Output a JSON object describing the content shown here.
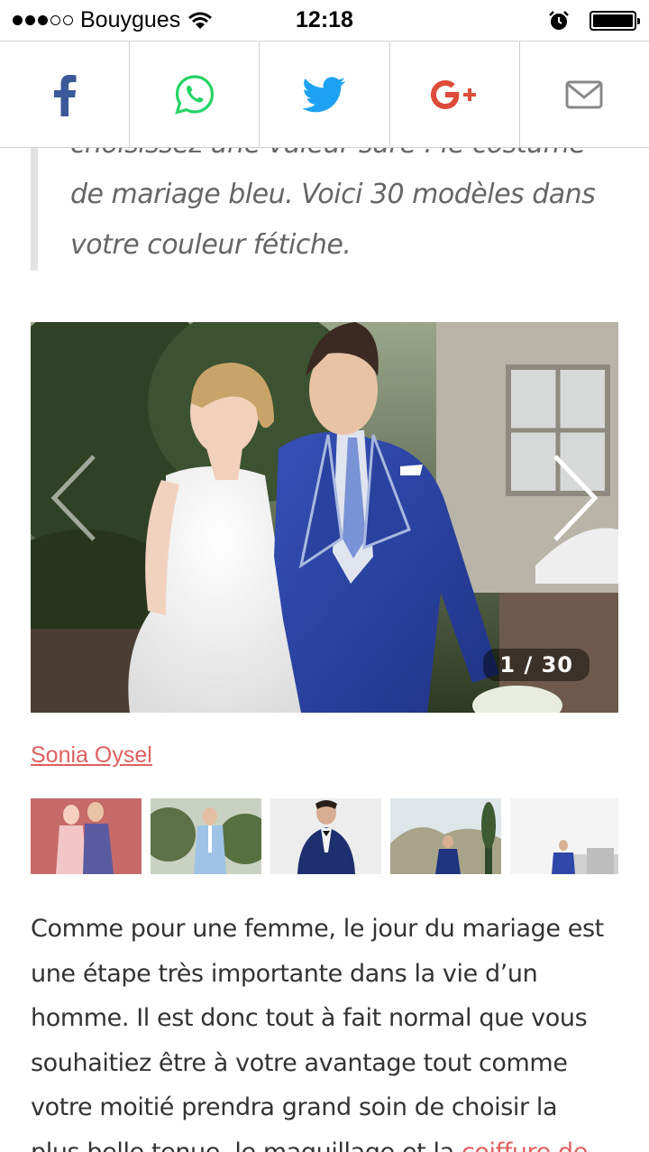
{
  "status_bar": {
    "carrier": "Bouygues",
    "time": "12:18",
    "signal_bars": 3,
    "signal_total": 5,
    "battery_level": 1.0
  },
  "share_bar": {
    "buttons": [
      {
        "network": "facebook",
        "icon": "facebook-icon",
        "color": "#3b5998"
      },
      {
        "network": "whatsapp",
        "icon": "whatsapp-icon",
        "color": "#25d366"
      },
      {
        "network": "twitter",
        "icon": "twitter-icon",
        "color": "#1da1f2"
      },
      {
        "network": "google-plus",
        "icon": "google-plus-icon",
        "color": "#dd4b39",
        "label": "G+"
      },
      {
        "network": "email",
        "icon": "envelope-icon",
        "color": "#888888"
      }
    ]
  },
  "article": {
    "quote_partial_line": "choisissez une valeur sûre : le costume",
    "quote_line_2": "de mariage bleu. Voici 30 modèles dans",
    "quote_line_3": "votre couleur fétiche.",
    "gallery": {
      "counter": "1 / 30",
      "image_alt": "wedding couple groom in blue suit",
      "credit": "Sonia Oysel"
    },
    "body_lines": [
      "Comme pour une femme, le jour du mariage est",
      "une étape très importante dans la vie d’un",
      "homme. Il est donc tout à fait normal que vous",
      "souhaitiez être à votre avantage tout comme",
      "votre moitié prendra grand soin de choisir la"
    ],
    "body_last_line_text": "plus belle tenue, le maquillage et la ",
    "body_last_line_link": "coiffure de"
  },
  "colors": {
    "link": "#e06060",
    "quote_border": "#e2e2e2",
    "suit_blue": "#2c45a0"
  }
}
